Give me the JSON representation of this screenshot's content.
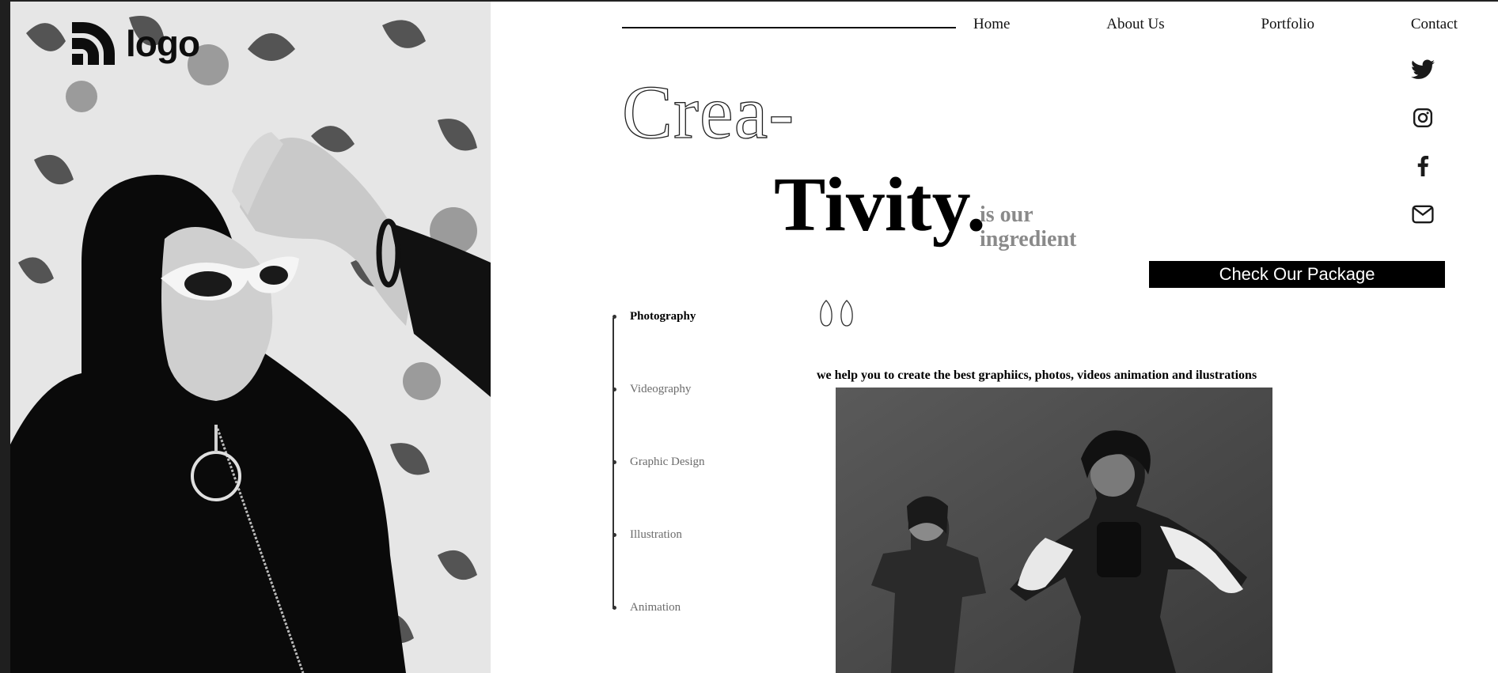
{
  "brand": {
    "logo_text": "logo"
  },
  "nav": {
    "items": [
      "Home",
      "About Us",
      "Portfolio",
      "Contact"
    ]
  },
  "social": {
    "icons": [
      "twitter-icon",
      "instagram-icon",
      "facebook-icon",
      "mail-icon"
    ]
  },
  "hero": {
    "line1": "Crea-",
    "line2": "Tivity.",
    "subtitle_line1": "is our",
    "subtitle_line2": "ingredient",
    "cta_label": "Check Our Package"
  },
  "services": {
    "items": [
      "Photography",
      "Videography",
      "Graphic Design",
      "Illustration",
      "Animation"
    ],
    "active": "Photography"
  },
  "content": {
    "tagline": "we help you to create the best graphiics, photos, videos animation and ilustrations"
  },
  "colors": {
    "text": "#000000",
    "muted": "#8a8a8a",
    "button_bg": "#000000",
    "button_text": "#ffffff",
    "background": "#ffffff"
  }
}
